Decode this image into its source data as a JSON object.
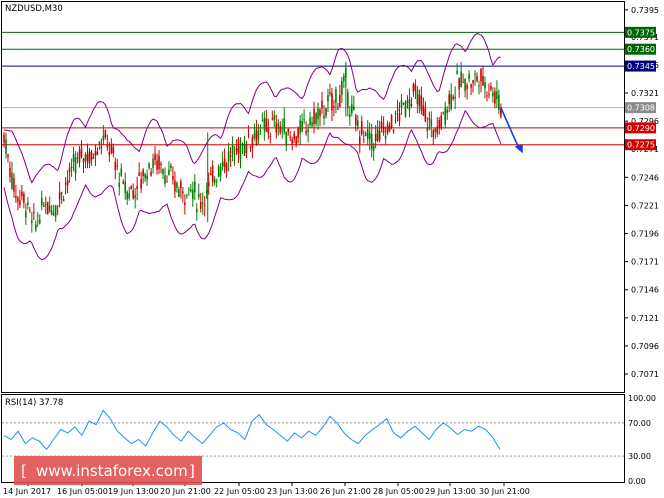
{
  "chart_data": {
    "type": "candlestick",
    "symbol_label": "NZDUSD,M30",
    "y_min": 0.7055,
    "y_max": 0.7402,
    "y_ticks": [
      "0.7395",
      "0.7371",
      "0.7346",
      "0.7321",
      "0.7296",
      "0.7271",
      "0.7246",
      "0.7221",
      "0.7196",
      "0.7171",
      "0.7146",
      "0.7121",
      "0.7096",
      "0.7071"
    ],
    "x_ticks": [
      "14 Jun 2017",
      "16 Jun 05:00",
      "19 Jun 13:00",
      "20 Jun 21:00",
      "22 Jun 05:00",
      "23 Jun 13:00",
      "26 Jun 21:00",
      "28 Jun 05:00",
      "29 Jun 13:00",
      "30 Jun 21:00"
    ],
    "levels": [
      {
        "value": 0.7375,
        "label": "0.7375",
        "color": "#006400",
        "tag_bg": "#006400",
        "tag_fg": "#ffffff"
      },
      {
        "value": 0.736,
        "label": "0.7360",
        "color": "#006400",
        "tag_bg": "#006400",
        "tag_fg": "#ffffff"
      },
      {
        "value": 0.7345,
        "label": "0.7345",
        "color": "#000080",
        "tag_bg": "#000080",
        "tag_fg": "#ffffff"
      },
      {
        "value": 0.7308,
        "label": "0.7308",
        "color": "#b0b0b0",
        "tag_bg": "#8c8c8c",
        "tag_fg": "#ffffff"
      },
      {
        "value": 0.729,
        "label": "0.7290",
        "color": "#d00000",
        "tag_bg": "#d00000",
        "tag_fg": "#ffffff"
      },
      {
        "value": 0.7275,
        "label": "0.7275",
        "color": "#d00000",
        "tag_bg": "#d00000",
        "tag_fg": "#ffffff"
      }
    ],
    "price_path": [
      [
        0,
        0.7283
      ],
      [
        6,
        0.7255
      ],
      [
        12,
        0.7231
      ],
      [
        18,
        0.7229
      ],
      [
        24,
        0.7219
      ],
      [
        30,
        0.7203
      ],
      [
        36,
        0.7213
      ],
      [
        42,
        0.7223
      ],
      [
        50,
        0.7219
      ],
      [
        58,
        0.7233
      ],
      [
        66,
        0.7248
      ],
      [
        74,
        0.726
      ],
      [
        82,
        0.7268
      ],
      [
        88,
        0.7263
      ],
      [
        94,
        0.7275
      ],
      [
        100,
        0.728
      ],
      [
        106,
        0.7273
      ],
      [
        112,
        0.7258
      ],
      [
        118,
        0.7243
      ],
      [
        124,
        0.7233
      ],
      [
        132,
        0.7236
      ],
      [
        140,
        0.7248
      ],
      [
        148,
        0.7258
      ],
      [
        156,
        0.726
      ],
      [
        164,
        0.7248
      ],
      [
        172,
        0.724
      ],
      [
        180,
        0.7233
      ],
      [
        188,
        0.7238
      ],
      [
        196,
        0.7223
      ],
      [
        202,
        0.723
      ],
      [
        210,
        0.7245
      ],
      [
        218,
        0.7258
      ],
      [
        226,
        0.7263
      ],
      [
        234,
        0.727
      ],
      [
        242,
        0.7275
      ],
      [
        250,
        0.7283
      ],
      [
        258,
        0.7288
      ],
      [
        266,
        0.729
      ],
      [
        274,
        0.7293
      ],
      [
        282,
        0.7288
      ],
      [
        290,
        0.7281
      ],
      [
        298,
        0.7286
      ],
      [
        306,
        0.7293
      ],
      [
        314,
        0.73
      ],
      [
        322,
        0.7306
      ],
      [
        330,
        0.7313
      ],
      [
        338,
        0.7318
      ],
      [
        344,
        0.733
      ],
      [
        350,
        0.7303
      ],
      [
        356,
        0.729
      ],
      [
        364,
        0.7283
      ],
      [
        372,
        0.7278
      ],
      [
        380,
        0.7286
      ],
      [
        388,
        0.7291
      ],
      [
        396,
        0.7301
      ],
      [
        404,
        0.7311
      ],
      [
        412,
        0.732
      ],
      [
        418,
        0.7313
      ],
      [
        424,
        0.73
      ],
      [
        430,
        0.729
      ],
      [
        436,
        0.7288
      ],
      [
        442,
        0.7301
      ],
      [
        448,
        0.7316
      ],
      [
        456,
        0.7328
      ],
      [
        464,
        0.7333
      ],
      [
        472,
        0.7331
      ],
      [
        478,
        0.7336
      ],
      [
        484,
        0.7329
      ],
      [
        490,
        0.7326
      ],
      [
        496,
        0.7318
      ],
      [
        500,
        0.7308
      ]
    ],
    "bollinger_width": 0.0032,
    "forecast_arrow": {
      "from": [
        500,
        0.7308
      ],
      "to": [
        518,
        0.727
      ]
    },
    "indicator": {
      "label": "RSI(14) 37.78",
      "y_ticks": [
        "100.00",
        "70.00",
        "30.00",
        "0.00"
      ],
      "levels": [
        70,
        30
      ],
      "values": [
        55,
        50,
        60,
        45,
        52,
        48,
        38,
        50,
        62,
        58,
        65,
        55,
        72,
        68,
        85,
        75,
        60,
        52,
        45,
        50,
        42,
        58,
        72,
        65,
        55,
        48,
        60,
        52,
        45,
        55,
        65,
        70,
        62,
        58,
        50,
        72,
        80,
        68,
        62,
        55,
        48,
        58,
        52,
        60,
        55,
        65,
        78,
        70,
        58,
        50,
        45,
        55,
        62,
        68,
        75,
        58,
        52,
        60,
        66,
        58,
        50,
        62,
        70,
        64,
        56,
        62,
        60,
        66,
        62,
        52,
        38
      ]
    }
  },
  "watermark": "www.instaforex.com"
}
